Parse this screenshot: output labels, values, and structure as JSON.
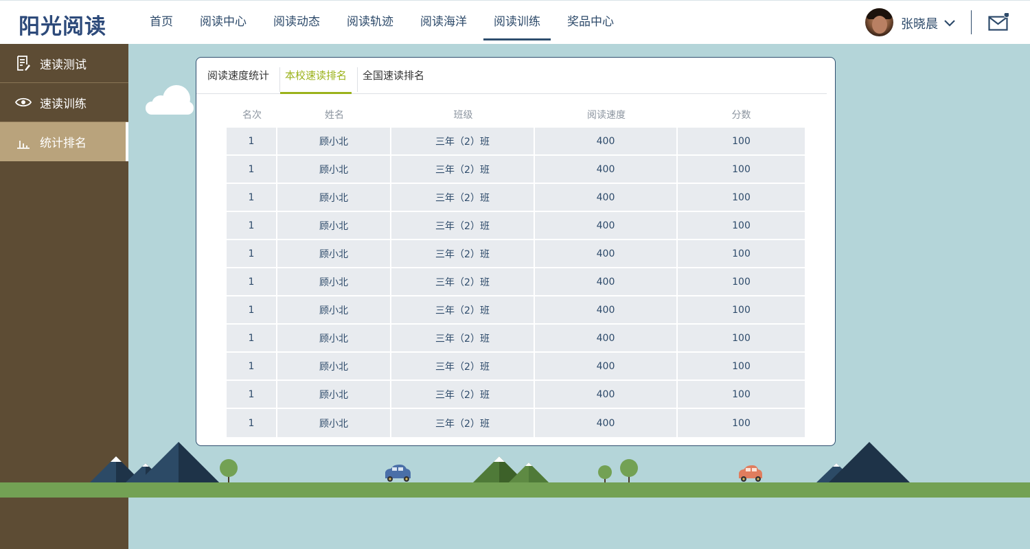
{
  "header": {
    "logo": "阳光阅读",
    "nav": [
      {
        "label": "首页",
        "active": false
      },
      {
        "label": "阅读中心",
        "active": false
      },
      {
        "label": "阅读动态",
        "active": false
      },
      {
        "label": "阅读轨迹",
        "active": false
      },
      {
        "label": "阅读海洋",
        "active": false
      },
      {
        "label": "阅读训练",
        "active": true
      },
      {
        "label": "奖品中心",
        "active": false
      }
    ],
    "user_name": "张晓晨"
  },
  "sidebar": {
    "items": [
      {
        "label": "速读测试",
        "icon": "document-edit-icon",
        "active": false
      },
      {
        "label": "速读训练",
        "icon": "eye-icon",
        "active": false
      },
      {
        "label": "统计排名",
        "icon": "bar-chart-icon",
        "active": true
      }
    ]
  },
  "tabs": [
    {
      "label": "阅读速度统计",
      "active": false
    },
    {
      "label": "本校速读排名",
      "active": true
    },
    {
      "label": "全国速读排名",
      "active": false
    }
  ],
  "table": {
    "headers": [
      "名次",
      "姓名",
      "班级",
      "阅读速度",
      "分数"
    ],
    "rows": [
      [
        "1",
        "顾小北",
        "三年（2）班",
        "400",
        "100"
      ],
      [
        "1",
        "顾小北",
        "三年（2）班",
        "400",
        "100"
      ],
      [
        "1",
        "顾小北",
        "三年（2）班",
        "400",
        "100"
      ],
      [
        "1",
        "顾小北",
        "三年（2）班",
        "400",
        "100"
      ],
      [
        "1",
        "顾小北",
        "三年（2）班",
        "400",
        "100"
      ],
      [
        "1",
        "顾小北",
        "三年（2）班",
        "400",
        "100"
      ],
      [
        "1",
        "顾小北",
        "三年（2）班",
        "400",
        "100"
      ],
      [
        "1",
        "顾小北",
        "三年（2）班",
        "400",
        "100"
      ],
      [
        "1",
        "顾小北",
        "三年（2）班",
        "400",
        "100"
      ],
      [
        "1",
        "顾小北",
        "三年（2）班",
        "400",
        "100"
      ],
      [
        "1",
        "顾小北",
        "三年（2）班",
        "400",
        "100"
      ]
    ]
  },
  "colors": {
    "brand": "#2d4a7a",
    "accent": "#9bb21a",
    "sidebar": "#5d4c34",
    "sidebar_active": "#b9a37c",
    "background": "#b4d5d9",
    "ground": "#73a154"
  }
}
